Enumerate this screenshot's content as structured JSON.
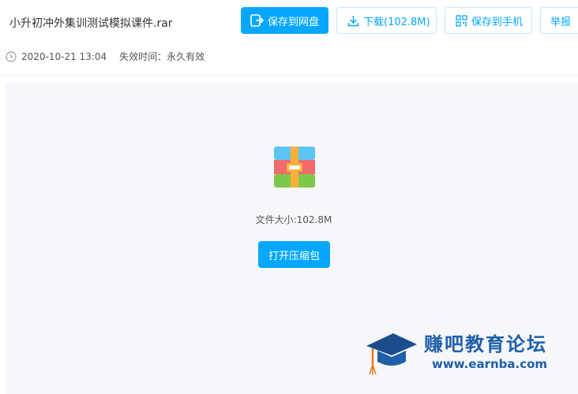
{
  "file": {
    "name": "小升初冲外集训测试模拟课件.rar",
    "date": "2020-10-21 13:04",
    "expiry": "失效时间：永久有效",
    "size_label": "文件大小:102.8M"
  },
  "toolbar": {
    "save_cloud": "保存到网盘",
    "download": "下载(102.8M)",
    "save_phone": "保存到手机",
    "report": "举报"
  },
  "actions": {
    "open_archive": "打开压缩包"
  },
  "icons": {
    "save": "save-to-cloud-icon",
    "download": "download-icon",
    "qrcode": "qrcode-icon",
    "clock": "clock-icon",
    "archive": "rar-archive-icon",
    "logo": "graduation-cap-logo"
  },
  "watermark": {
    "title": "赚吧教育论坛",
    "url": "www.earnba.com"
  },
  "colors": {
    "accent": "#06a7ff",
    "panel_bg": "#f5f7fa",
    "watermark": "#1f5fa8"
  }
}
